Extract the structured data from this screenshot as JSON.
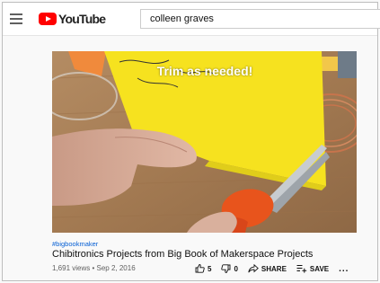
{
  "header": {
    "logo_text": "YouTube",
    "search_value": "colleen graves"
  },
  "video": {
    "overlay_text": "Trim as needed!"
  },
  "info": {
    "hashtag": "#bigbookmaker",
    "title": "Chibitronics Projects from Big Book of Makerspace Projects",
    "meta": "1,691 views • Sep 2, 2016"
  },
  "actions": {
    "like_count": "5",
    "dislike_count": "0",
    "share_label": "SHARE",
    "save_label": "SAVE",
    "more_label": "..."
  },
  "colors": {
    "brand_red": "#ff0000",
    "link_blue": "#065fd4",
    "paper_yellow": "#f6e21f",
    "scissors_orange": "#e8541c"
  }
}
